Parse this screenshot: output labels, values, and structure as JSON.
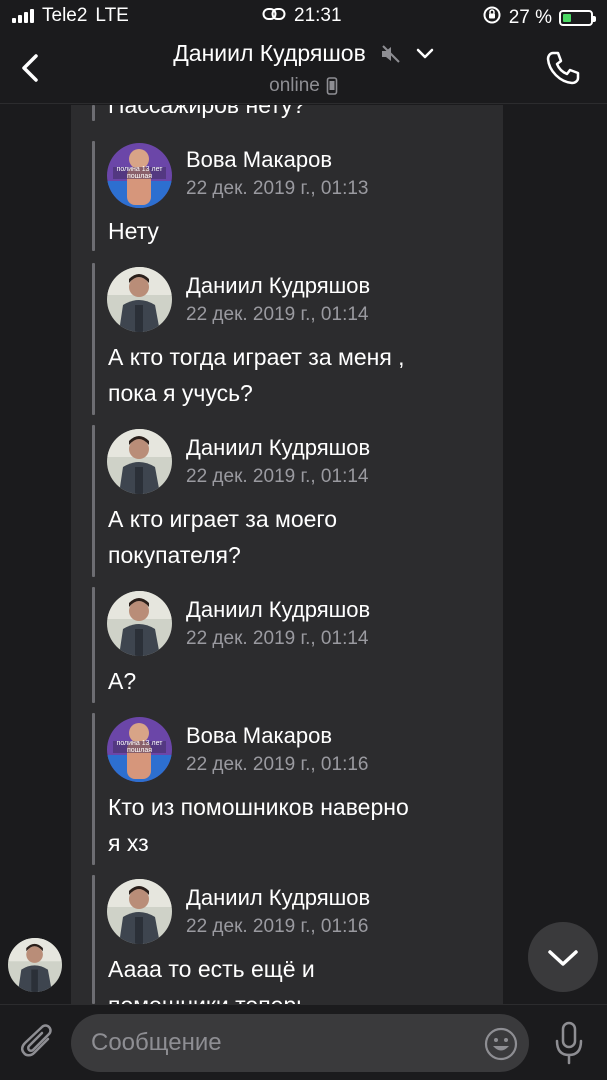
{
  "status_bar": {
    "carrier": "Tele2",
    "network": "LTE",
    "time": "21:31",
    "battery": "27 %",
    "battery_level": 0.27,
    "icons": [
      "signal-icon",
      "link-icon",
      "orientation-lock-icon",
      "battery-icon"
    ]
  },
  "header": {
    "back_icon": "chevron-left-icon",
    "title": "Даниил Кудряшов",
    "muted_icon": "muted-speaker-icon",
    "dropdown_icon": "chevron-down-icon",
    "subtitle": "online",
    "device_icon": "mobile-device-icon",
    "call_icon": "phone-icon"
  },
  "messages": [
    {
      "text": "Пассажиров нету?"
    },
    {
      "author": "Вова Макаров",
      "date": "22 дек. 2019 г., 01:13",
      "text": "Нету",
      "avatar_text": "полина 13 лет пошлая"
    },
    {
      "author": "Даниил Кудряшов",
      "date": "22 дек. 2019 г., 01:14",
      "text_lines": [
        "А кто тогда играет за меня ,",
        "пока я учусь?"
      ]
    },
    {
      "author": "Даниил Кудряшов",
      "date": "22 дек. 2019 г., 01:14",
      "text_lines": [
        "А кто играет за моего",
        "покупателя?"
      ]
    },
    {
      "author": "Даниил Кудряшов",
      "date": "22 дек. 2019 г., 01:14",
      "text": "А?"
    },
    {
      "author": "Вова Макаров",
      "date": "22 дек. 2019 г., 01:16",
      "text_lines": [
        "Кто из помошников наверно",
        "я хз"
      ],
      "avatar_text": "полина 13 лет пошлая"
    },
    {
      "author": "Даниил Кудряшов",
      "date": "22 дек. 2019 г., 01:16",
      "text_lines": [
        "Аааа то есть ещё и",
        "помошники теперь"
      ]
    }
  ],
  "scroll_down_icon": "chevron-down-icon",
  "input": {
    "attach_icon": "paperclip-icon",
    "placeholder": "Сообщение",
    "value": "",
    "emoji_icon": "smiley-icon",
    "mic_icon": "microphone-icon"
  },
  "colors": {
    "background": "#1b1b1d",
    "card": "#2c2c2e",
    "quote_line": "#6d6d72",
    "secondary_text": "#9a9aa0",
    "battery_green": "#4cd964"
  }
}
